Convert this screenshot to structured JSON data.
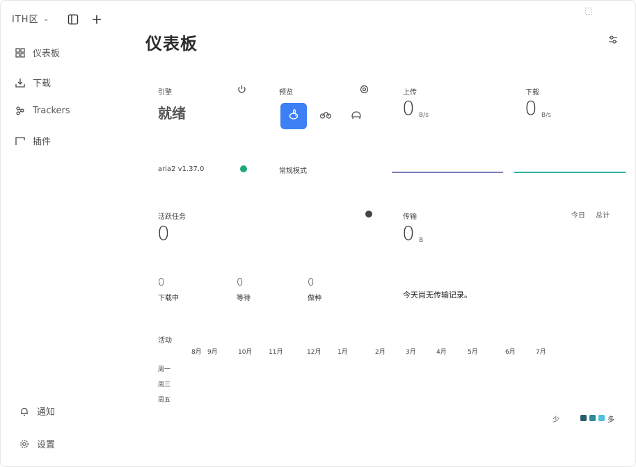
{
  "app": {
    "brand": "ITH区",
    "brand_chevron": "⌄"
  },
  "sidebar": {
    "items": [
      {
        "label": "仪表板",
        "icon": "dashboard-icon"
      },
      {
        "label": "下载",
        "icon": "download-icon"
      },
      {
        "label": "Trackers",
        "icon": "trackers-icon"
      },
      {
        "label": "插件",
        "icon": "plugin-icon"
      }
    ],
    "bottom": [
      {
        "label": "通知",
        "icon": "bell-icon"
      },
      {
        "label": "设置",
        "icon": "gear-icon"
      }
    ]
  },
  "main": {
    "title": "仪表板",
    "engine": {
      "label": "引擎",
      "status": "就绪",
      "version": "aria2 v1.37.0",
      "status_color": "#19a974"
    },
    "speed": {
      "label": "预览",
      "mode_text": "常规模式"
    },
    "upload": {
      "label": "上传",
      "value": "0",
      "unit": "B/s",
      "line_color": "#7b7fb8"
    },
    "download": {
      "label": "下载",
      "value": "0",
      "unit": "B/s",
      "line_color": "#2bb5a3"
    },
    "active": {
      "label": "活跃任务",
      "value": "0",
      "stats": [
        {
          "value": "0",
          "label": "下载中"
        },
        {
          "value": "0",
          "label": "等待"
        },
        {
          "value": "0",
          "label": "做种"
        }
      ]
    },
    "transfer": {
      "label": "传输",
      "value": "0",
      "unit": "B",
      "tab_today": "今日",
      "tab_total": "总计",
      "empty_text": "今天尚无传输记录。"
    },
    "heatmap": {
      "label": "活动",
      "months": [
        "8月",
        "9月",
        "10月",
        "11月",
        "12月",
        "1月",
        "2月",
        "3月",
        "4月",
        "5月",
        "6月",
        "7月"
      ],
      "weekdays": [
        "周一",
        "周三",
        "周五"
      ],
      "legend_less": "少",
      "legend_more": "多",
      "legend_colors": [
        "#2a5c6b",
        "#2f8a9a",
        "#4fc3d9"
      ]
    }
  }
}
